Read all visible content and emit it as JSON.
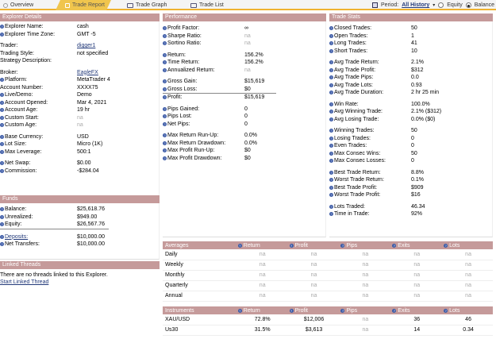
{
  "tabs": [
    {
      "label": "Overview"
    },
    {
      "label": "Trade Report"
    },
    {
      "label": "Trade Graph"
    },
    {
      "label": "Trade List"
    }
  ],
  "period": {
    "label": "Period:",
    "value": "All History",
    "options": [
      "Equity",
      "Balance"
    ],
    "selected": "Balance"
  },
  "explorer": {
    "title": "Explorer Details",
    "rows": [
      {
        "label": "Explorer Name:",
        "value": "cash",
        "q": true
      },
      {
        "label": "Explorer Time Zone:",
        "value": "GMT -5",
        "q": true
      },
      {
        "gap": true
      },
      {
        "label": "Trader:",
        "value": "digger1",
        "link": true
      },
      {
        "label": "Trading Style:",
        "value": "not specified"
      },
      {
        "label": "Strategy Description:",
        "value": ""
      },
      {
        "gap": true
      },
      {
        "label": "Broker:",
        "value": "EagleFX",
        "link": true
      },
      {
        "label": "Platform:",
        "value": "MetaTrader 4",
        "q": true
      },
      {
        "label": "Account Number:",
        "value": "XXXX75"
      },
      {
        "label": "Live/Demo:",
        "value": "Demo",
        "q": true
      },
      {
        "label": "Account Opened:",
        "value": "Mar 4, 2021",
        "q": true
      },
      {
        "label": "Account Age:",
        "value": "19 hr",
        "q": true
      },
      {
        "label": "Custom Start:",
        "value": "na",
        "q": true,
        "muted": true
      },
      {
        "label": "Custom Age:",
        "value": "na",
        "q": true,
        "muted": true
      },
      {
        "gap": true
      },
      {
        "label": "Base Currency:",
        "value": "USD",
        "q": true
      },
      {
        "label": "Lot Size:",
        "value": "Micro (1K)",
        "q": true
      },
      {
        "label": "Max Leverage:",
        "value": "500:1",
        "q": true
      },
      {
        "gap": true
      },
      {
        "label": "Net Swap:",
        "value": "$0.00",
        "q": true
      },
      {
        "label": "Commission:",
        "value": "-$284.04",
        "q": true
      }
    ]
  },
  "funds": {
    "title": "Funds",
    "rows": [
      {
        "label": "Balance:",
        "value": "$25,618.76",
        "q": true
      },
      {
        "label": "Unrealized:",
        "value": "$949.00",
        "q": true
      },
      {
        "label": "Equity:",
        "value": "$26,567.76",
        "q": true,
        "sep": true
      },
      {
        "gap": true
      },
      {
        "label": "Deposits:",
        "value": "$10,000.00",
        "q": true,
        "linklabel": true
      },
      {
        "label": "Net Transfers:",
        "value": "$10,000.00",
        "q": true
      }
    ]
  },
  "linked": {
    "title": "Linked Threads",
    "text": "There are no threads linked to this Explorer.",
    "link": "Start Linked Thread"
  },
  "performance": {
    "title": "Performance",
    "rows": [
      {
        "label": "Profit Factor:",
        "value": "∞",
        "q": true
      },
      {
        "label": "Sharpe Ratio:",
        "value": "na",
        "q": true,
        "muted": true
      },
      {
        "label": "Sortino Ratio:",
        "value": "na",
        "q": true,
        "muted": true
      },
      {
        "gap": true
      },
      {
        "label": "Return:",
        "value": "156.2%",
        "q": true
      },
      {
        "label": "Time Return:",
        "value": "156.2%",
        "q": true
      },
      {
        "label": "Annualized Return:",
        "value": "na",
        "q": true,
        "muted": true
      },
      {
        "gap": true
      },
      {
        "label": "Gross Gain:",
        "value": "$15,619",
        "q": true
      },
      {
        "label": "Gross Loss:",
        "value": "$0",
        "q": true,
        "sep": true
      },
      {
        "label": "Profit:",
        "value": "$15,619",
        "q": true
      },
      {
        "gap": true
      },
      {
        "label": "Pips Gained:",
        "value": "0",
        "q": true
      },
      {
        "label": "Pips Lost:",
        "value": "0",
        "q": true
      },
      {
        "label": "Net Pips:",
        "value": "0",
        "q": true
      },
      {
        "gap": true
      },
      {
        "label": "Max Return Run-Up:",
        "value": "0.0%",
        "q": true
      },
      {
        "label": "Max Return Drawdown:",
        "value": "0.0%",
        "q": true
      },
      {
        "label": "Max Profit Run-Up:",
        "value": "$0",
        "q": true
      },
      {
        "label": "Max Profit Drawdown:",
        "value": "$0",
        "q": true
      }
    ]
  },
  "stats": {
    "title": "Trade Stats",
    "rows": [
      {
        "label": "Closed Trades:",
        "value": "50",
        "q": true
      },
      {
        "label": "Open Trades:",
        "value": "1",
        "q": true
      },
      {
        "label": "Long Trades:",
        "value": "41",
        "q": true
      },
      {
        "label": "Short Trades:",
        "value": "10",
        "q": true
      },
      {
        "gap": true
      },
      {
        "label": "Avg Trade Return:",
        "value": "2.1%",
        "q": true
      },
      {
        "label": "Avg Trade Profit:",
        "value": "$312",
        "q": true
      },
      {
        "label": "Avg Trade Pips:",
        "value": "0.0",
        "q": true
      },
      {
        "label": "Avg Trade Lots:",
        "value": "0.93",
        "q": true
      },
      {
        "label": "Avg Trade Duration:",
        "value": "2 hr 25 min",
        "q": true
      },
      {
        "gap": true
      },
      {
        "label": "Win Rate:",
        "value": "100.0%",
        "q": true
      },
      {
        "label": "Avg Winning Trade:",
        "value": "2.1% ($312)",
        "q": true
      },
      {
        "label": "Avg Losing Trade:",
        "value": "0.0% ($0)",
        "q": true
      },
      {
        "gap": true
      },
      {
        "label": "Winning Trades:",
        "value": "50",
        "q": true
      },
      {
        "label": "Losing Trades:",
        "value": "0",
        "q": true
      },
      {
        "label": "Even Trades:",
        "value": "0",
        "q": true
      },
      {
        "label": "Max Consec Wins:",
        "value": "50",
        "q": true
      },
      {
        "label": "Max Consec Losses:",
        "value": "0",
        "q": true
      },
      {
        "gap": true
      },
      {
        "label": "Best Trade Return:",
        "value": "8.8%",
        "q": true
      },
      {
        "label": "Worst Trade Return:",
        "value": "0.1%",
        "q": true
      },
      {
        "label": "Best Trade Profit:",
        "value": "$909",
        "q": true
      },
      {
        "label": "Worst Trade Profit:",
        "value": "$16",
        "q": true
      },
      {
        "gap": true
      },
      {
        "label": "Lots Traded:",
        "value": "46.34",
        "q": true
      },
      {
        "label": "Time in Trade:",
        "value": "92%",
        "q": true
      }
    ]
  },
  "averages": {
    "headers": [
      "Averages",
      "Return",
      "Profit",
      "Pips",
      "Exits",
      "Lots"
    ],
    "rows": [
      {
        "label": "Daily",
        "cells": [
          "na",
          "na",
          "na",
          "na",
          "na"
        ]
      },
      {
        "label": "Weekly",
        "cells": [
          "na",
          "na",
          "na",
          "na",
          "na"
        ]
      },
      {
        "label": "Monthly",
        "cells": [
          "na",
          "na",
          "na",
          "na",
          "na"
        ]
      },
      {
        "label": "Quarterly",
        "cells": [
          "na",
          "na",
          "na",
          "na",
          "na"
        ]
      },
      {
        "label": "Annual",
        "cells": [
          "na",
          "na",
          "na",
          "na",
          "na"
        ]
      }
    ]
  },
  "instruments": {
    "headers": [
      "Instruments",
      "Return",
      "Profit",
      "Pips",
      "Exits",
      "Lots"
    ],
    "rows": [
      {
        "label": "XAU/USD",
        "cells": [
          "72.8%",
          "$12,006",
          "na",
          "36",
          "46"
        ]
      },
      {
        "label": "Us30",
        "cells": [
          "31.5%",
          "$3,613",
          "na",
          "14",
          "0.34"
        ]
      }
    ]
  }
}
